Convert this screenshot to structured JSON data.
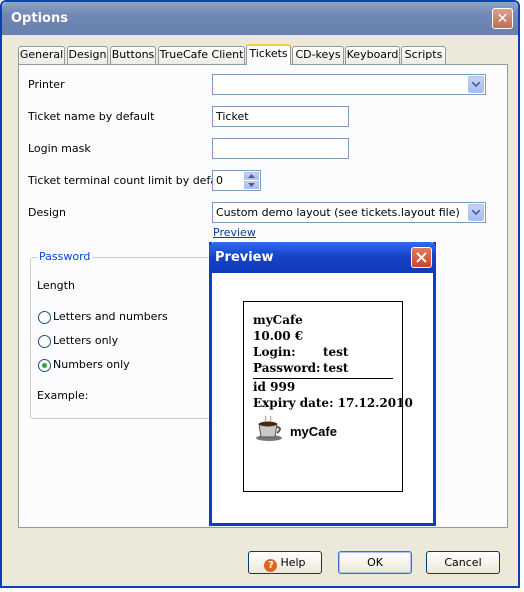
{
  "window": {
    "title": "Options",
    "close": "✕"
  },
  "tabs": [
    "General",
    "Design",
    "Buttons",
    "TrueCafe Client",
    "Tickets",
    "CD-keys",
    "Keyboard",
    "Scripts"
  ],
  "active_tab": "Tickets",
  "form": {
    "printer_label": "Printer",
    "printer_value": "",
    "ticket_name_label": "Ticket name by default",
    "ticket_name_value": "Ticket",
    "login_mask_label": "Login mask",
    "login_mask_value": "",
    "terminal_limit_label": "Ticket terminal count limit by default",
    "terminal_limit_value": "0",
    "design_label": "Design",
    "design_value": "Custom demo layout (see tickets.layout file)",
    "preview_link": "Preview"
  },
  "password": {
    "group_title": "Password",
    "length_label": "Length",
    "options": [
      "Letters and numbers",
      "Letters only",
      "Numbers only"
    ],
    "selected": "Numbers only",
    "example_label": "Example:"
  },
  "preview_window": {
    "title": "Preview",
    "ticket": {
      "cafe": "myCafe",
      "price": "10.00 €",
      "login_label": "Login:",
      "login_value": "test",
      "password_label": "Password:",
      "password_value": "test",
      "id": "id 999",
      "expiry": "Expiry date: 17.12.2010",
      "brand": "myCafe"
    }
  },
  "buttons": {
    "help": "Help",
    "ok": "OK",
    "cancel": "Cancel"
  }
}
